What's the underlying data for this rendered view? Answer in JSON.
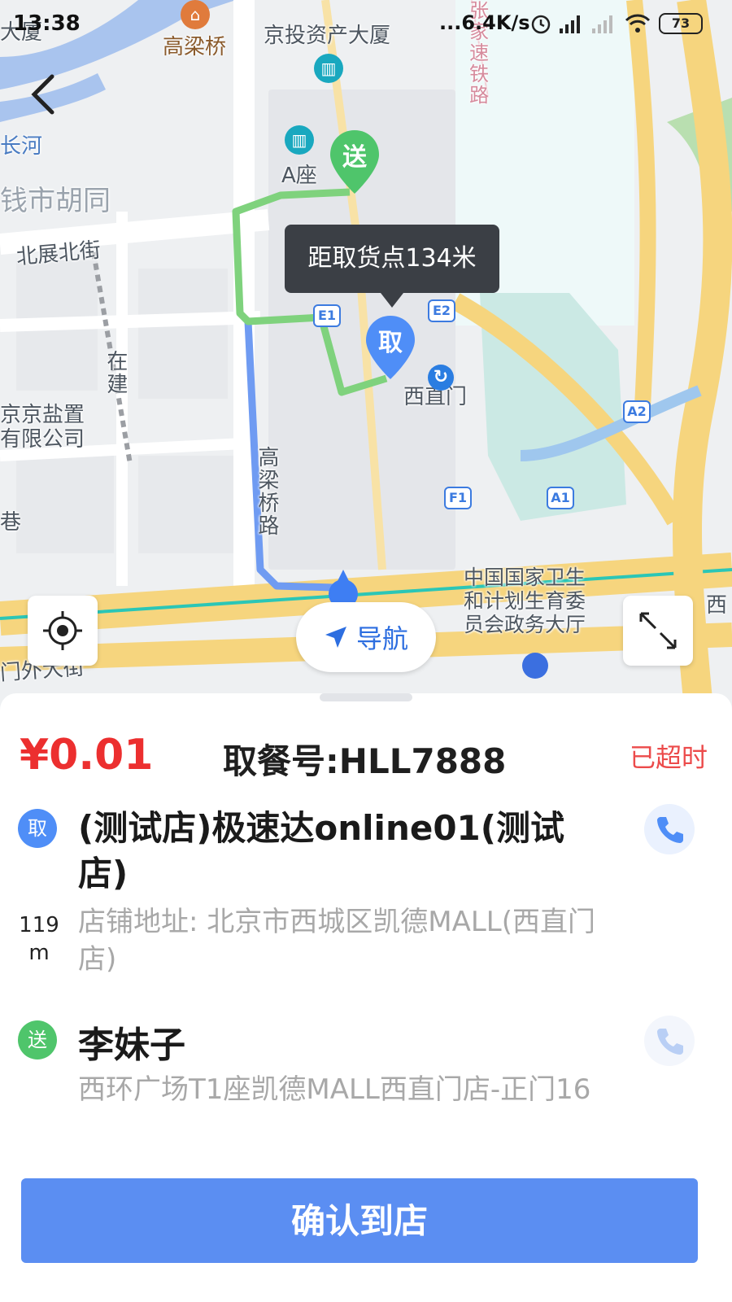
{
  "status_bar": {
    "time": "13:38",
    "speed": "...6.4K/s",
    "battery": "73"
  },
  "map": {
    "labels": {
      "dasha": "大厦",
      "gaoliangqiao": "高梁桥",
      "jingtou": "京投资产大厦",
      "changhe": "长河",
      "qianshi": "钱市胡同",
      "a_zuo": "A座",
      "beizhan": "北展北街",
      "zaijian": "在建",
      "yanye": "京京盐置\n有限公司",
      "xiang": "巷",
      "gaoliangqiao_road": "高梁桥路",
      "xizhimen": "西直门",
      "health": "中国国家卫生\n和计划生育委\n员会政务大厅",
      "waidajie": "门外大街",
      "xi": "西",
      "railway": "张家速铁路"
    },
    "pickup_pin": "取",
    "deliver_pin": "送",
    "tooltip": "距取货点134米",
    "exits": [
      "E1",
      "E2",
      "A2",
      "F1",
      "A1"
    ],
    "nav_label": "导航"
  },
  "order": {
    "price": "¥0.01",
    "ticket_no": "取餐号:HLL7888",
    "status": "已超时",
    "pickup": {
      "badge": "取",
      "shop_name": "(测试店)极速达online01(测试店)",
      "distance_value": "119",
      "distance_unit": "m",
      "address": "店铺地址: 北京市西城区凯德MALL(西直门店)"
    },
    "delivery": {
      "badge": "送",
      "receiver": "李妹子",
      "address": "西环广场T1座凯德MALL西直门店-正门16"
    },
    "confirm_label": "确认到店"
  },
  "colors": {
    "price": "#ec2f2f",
    "overdue": "#ec4b4b",
    "pickup_blue": "#4f8ef7",
    "deliver_green": "#4fc56b",
    "button": "#5b8ef2"
  }
}
